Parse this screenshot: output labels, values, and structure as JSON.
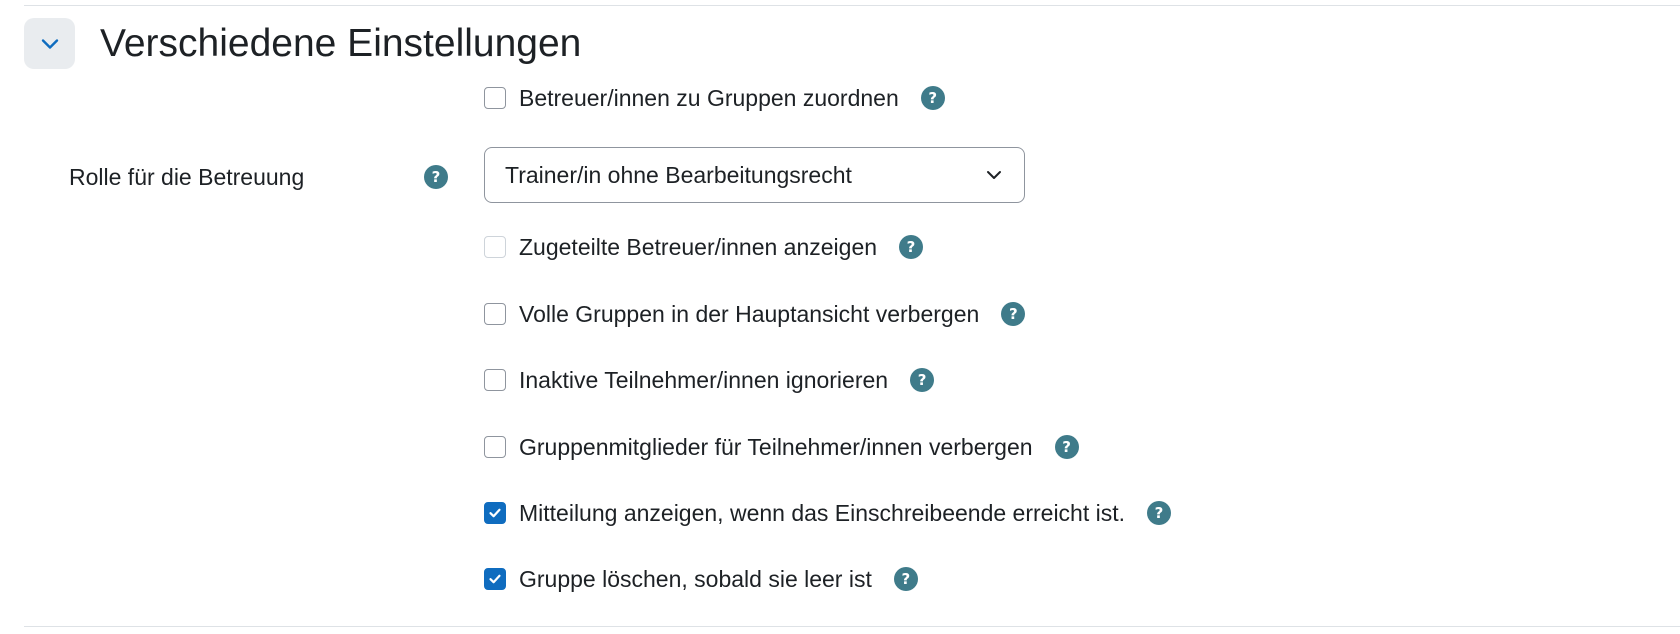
{
  "section": {
    "title": "Verschiedene Einstellungen",
    "expanded": true
  },
  "help_icon_glyph": "?",
  "colors": {
    "accent": "#0f6cbf",
    "help_icon": "#3f7b8a",
    "text": "#1d2125",
    "toggle_bg": "#e9ecef"
  },
  "settings": {
    "assign_tutors": {
      "label": "Betreuer/innen zu Gruppen zuordnen",
      "checked": false
    },
    "tutor_role": {
      "label": "Rolle für die Betreuung",
      "selected": "Trainer/in ohne Bearbeitungsrecht"
    },
    "show_tutors": {
      "label": "Zugeteilte Betreuer/innen anzeigen",
      "checked": false,
      "disabled": true
    },
    "hide_full_groups": {
      "label": "Volle Gruppen in der Hauptansicht verbergen",
      "checked": false
    },
    "ignore_inactive": {
      "label": "Inaktive Teilnehmer/innen ignorieren",
      "checked": false
    },
    "hide_members": {
      "label": "Gruppenmitglieder für Teilnehmer/innen verbergen",
      "checked": false
    },
    "show_enrolment_end_message": {
      "label": "Mitteilung anzeigen, wenn das Einschreibeende erreicht ist.",
      "checked": true
    },
    "delete_empty_group": {
      "label": "Gruppe löschen, sobald sie leer ist",
      "checked": true
    }
  }
}
